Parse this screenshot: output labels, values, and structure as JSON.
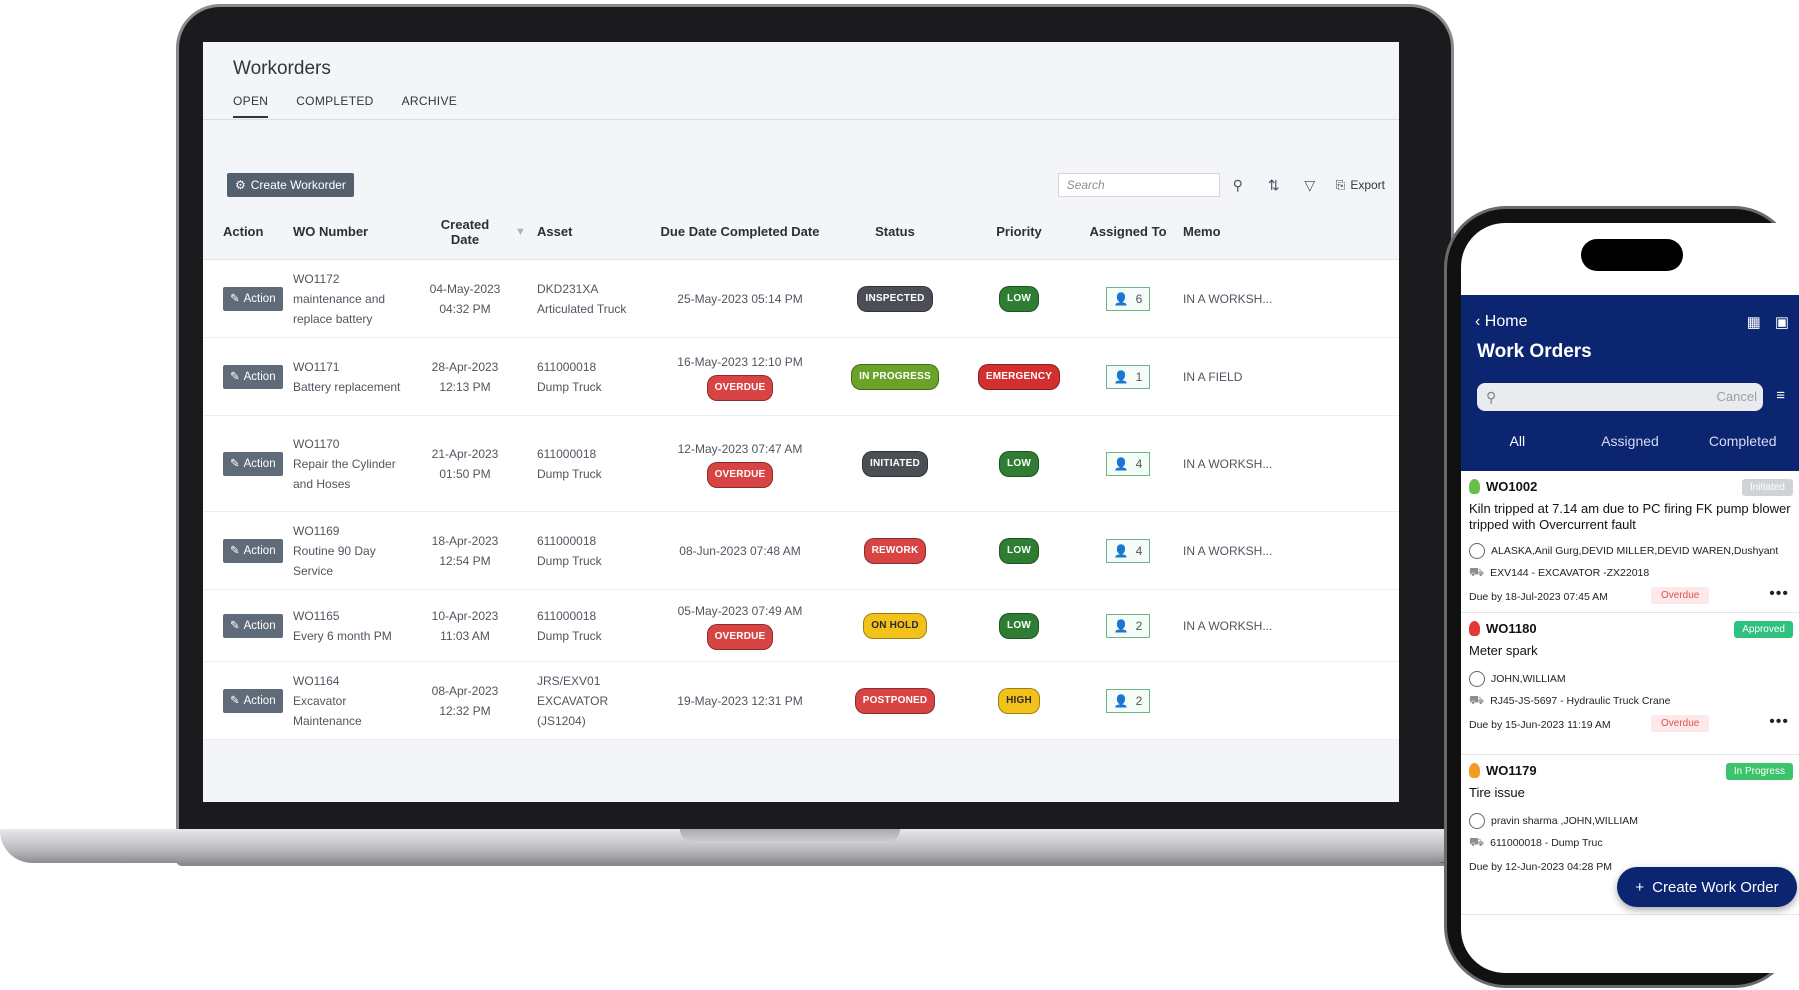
{
  "app": {
    "title": "Workorders",
    "tabs": [
      "OPEN",
      "COMPLETED",
      "ARCHIVE"
    ],
    "active_tab": "OPEN"
  },
  "toolbar": {
    "create_label": "Create Workorder",
    "search_placeholder": "Search",
    "export_label": "Export"
  },
  "columns": {
    "action": "Action",
    "wo_number": "WO Number",
    "created": "Created Date",
    "asset": "Asset",
    "due": "Due Date Completed Date",
    "status": "Status",
    "priority": "Priority",
    "assigned": "Assigned To",
    "memo": "Memo"
  },
  "rows": [
    {
      "action": "Action",
      "wo": "WO1172",
      "desc": "maintenance and replace battery",
      "created_date": "04-May-2023",
      "created_time": "04:32 PM",
      "asset_id": "DKD231XA",
      "asset_name": "Articulated Truck",
      "due": "25-May-2023 05:14 PM",
      "overdue": "",
      "status": "INSPECTED",
      "status_color": "#4b4f55",
      "priority": "LOW",
      "priority_color": "#2e7d32",
      "assigned": "6",
      "memo": "IN A WORKSH..."
    },
    {
      "action": "Action",
      "wo": "WO1171",
      "desc": "Battery replacement",
      "created_date": "28-Apr-2023",
      "created_time": "12:13 PM",
      "asset_id": "611000018",
      "asset_name": "Dump Truck",
      "due": "16-May-2023 12:10 PM",
      "overdue": "OVERDUE",
      "status": "IN PROGRESS",
      "status_color": "#6aa22a",
      "priority": "EMERGENCY",
      "priority_color": "#d32f2f",
      "assigned": "1",
      "memo": "IN A FIELD"
    },
    {
      "action": "Action",
      "wo": "WO1170",
      "desc": "Repair the Cylinder and Hoses",
      "created_date": "21-Apr-2023",
      "created_time": "01:50 PM",
      "asset_id": "611000018",
      "asset_name": "Dump Truck",
      "due": "12-May-2023 07:47 AM",
      "overdue": "OVERDUE",
      "status": "INITIATED",
      "status_color": "#4b4f55",
      "priority": "LOW",
      "priority_color": "#2e7d32",
      "assigned": "4",
      "memo": "IN A WORKSH..."
    },
    {
      "action": "Action",
      "wo": "WO1169",
      "desc": "Routine 90 Day Service",
      "created_date": "18-Apr-2023",
      "created_time": "12:54 PM",
      "asset_id": "611000018",
      "asset_name": "Dump Truck",
      "due": "08-Jun-2023 07:48 AM",
      "overdue": "",
      "status": "REWORK",
      "status_color": "#d84343",
      "priority": "LOW",
      "priority_color": "#2e7d32",
      "assigned": "4",
      "memo": "IN A WORKSH..."
    },
    {
      "action": "Action",
      "wo": "WO1165",
      "desc": "Every 6 month PM",
      "created_date": "10-Apr-2023",
      "created_time": "11:03 AM",
      "asset_id": "611000018",
      "asset_name": "Dump Truck",
      "due": "05-May-2023 07:49 AM",
      "overdue": "OVERDUE",
      "status": "ON HOLD",
      "status_color": "#f2c21b",
      "priority": "LOW",
      "priority_color": "#2e7d32",
      "assigned": "2",
      "memo": "IN A WORKSH..."
    },
    {
      "action": "Action",
      "wo": "WO1164",
      "desc": "Excavator Maintenance",
      "created_date": "08-Apr-2023",
      "created_time": "12:32 PM",
      "asset_id": "JRS/EXV01",
      "asset_name": "EXCAVATOR (JS1204)",
      "due": "19-May-2023 12:31 PM",
      "overdue": "",
      "status": "POSTPONED",
      "status_color": "#d84343",
      "priority": "HIGH",
      "priority_color": "#f2c21b",
      "assigned": "2",
      "memo": ""
    }
  ],
  "phone": {
    "back_label": "Home",
    "title": "Work Orders",
    "search_cancel": "Cancel",
    "tabs": [
      "All",
      "Assigned",
      "Completed"
    ],
    "cards": [
      {
        "id": "WO1002",
        "badge": "Initiated",
        "badge_color": "#cfd3d8",
        "flame_color": "#6abf4b",
        "text": "Kiln tripped at 7.14 am due to PC firing FK pump blower tripped  with Overcurrent fault",
        "users": "ALASKA,Anil Gurg,DEVID MILLER,DEVID WAREN,Dushyant",
        "asset": "EXV144 - EXCAVATOR -ZX22018",
        "due": "Due by 18-Jul-2023 07:45 AM",
        "overdue": "Overdue"
      },
      {
        "id": "WO1180",
        "badge": "Approved",
        "badge_color": "#2ec27e",
        "flame_color": "#e53935",
        "text": "Meter spark",
        "users": "JOHN,WILLIAM",
        "asset": "RJ45-JS-5697 - Hydraulic Truck Crane",
        "due": "Due by 15-Jun-2023 11:19 AM",
        "overdue": "Overdue"
      },
      {
        "id": "WO1179",
        "badge": "In Progress",
        "badge_color": "#3cc46a",
        "flame_color": "#f59a23",
        "text": "Tire issue",
        "users": "pravin sharma ,JOHN,WILLIAM",
        "asset": "611000018 - Dump Truc",
        "due": "Due by 12-Jun-2023 04:28 PM",
        "overdue": ""
      }
    ],
    "fab_label": "Create Work Order"
  }
}
